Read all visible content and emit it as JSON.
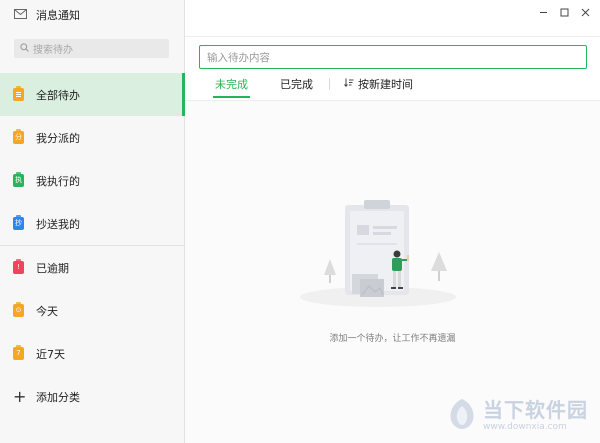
{
  "sidebar": {
    "title": "消息通知",
    "search_placeholder": "搜索待办",
    "items": [
      {
        "label": "全部待办",
        "color": "#f5a623",
        "glyph": "",
        "active": true
      },
      {
        "label": "我分派的",
        "color": "#f5a623",
        "glyph": "分",
        "active": false
      },
      {
        "label": "我执行的",
        "color": "#28b45a",
        "glyph": "执",
        "active": false
      },
      {
        "label": "抄送我的",
        "color": "#2f86e6",
        "glyph": "抄",
        "active": false
      }
    ],
    "filters": [
      {
        "label": "已逾期",
        "color": "#f0435e",
        "glyph": "!"
      },
      {
        "label": "今天",
        "color": "#f5a623",
        "glyph": "⊙"
      },
      {
        "label": "近7天",
        "color": "#f5a623",
        "glyph": "7"
      }
    ],
    "add_category_label": "添加分类"
  },
  "main": {
    "input_placeholder": "输入待办内容",
    "tabs": [
      {
        "label": "未完成",
        "active": true
      },
      {
        "label": "已完成",
        "active": false
      }
    ],
    "sort_label": "按新建时间",
    "empty_text": "添加一个待办，让工作不再遗漏"
  },
  "watermark": {
    "title": "当下软件园",
    "url": "www.downxia.com"
  },
  "colors": {
    "accent": "#28b45a",
    "active_bg": "#daefdf"
  }
}
